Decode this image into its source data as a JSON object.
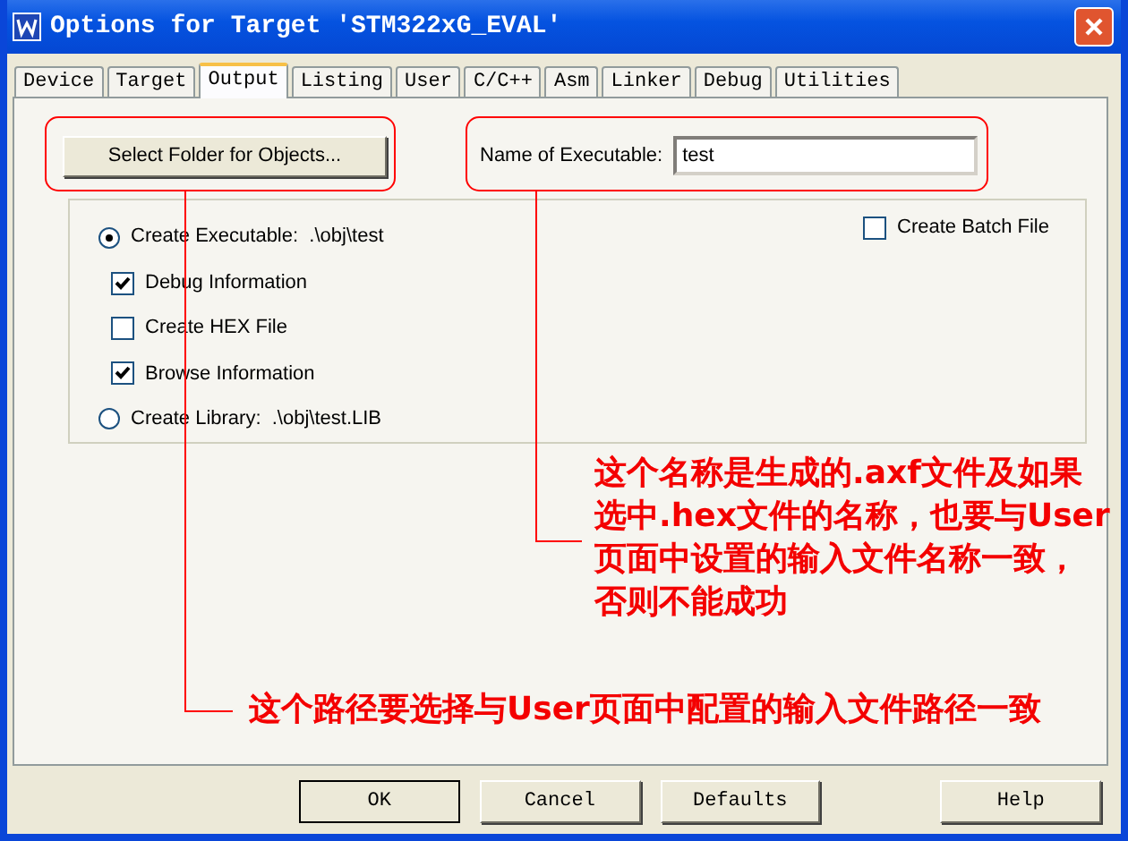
{
  "window": {
    "title": "Options for Target 'STM322xG_EVAL'"
  },
  "tabs": [
    {
      "label": "Device",
      "selected": false
    },
    {
      "label": "Target",
      "selected": false
    },
    {
      "label": "Output",
      "selected": true
    },
    {
      "label": "Listing",
      "selected": false
    },
    {
      "label": "User",
      "selected": false
    },
    {
      "label": "C/C++",
      "selected": false
    },
    {
      "label": "Asm",
      "selected": false
    },
    {
      "label": "Linker",
      "selected": false
    },
    {
      "label": "Debug",
      "selected": false
    },
    {
      "label": "Utilities",
      "selected": false
    }
  ],
  "output": {
    "select_folder_button": "Select Folder for Objects...",
    "name_label": "Name of Executable:",
    "name_value": "test",
    "options": [
      {
        "kind": "radio",
        "label": "Create Executable:  .\\obj\\test",
        "selected": true
      },
      {
        "kind": "checkbox",
        "label": "Debug Information",
        "checked": true
      },
      {
        "kind": "checkbox",
        "label": "Create HEX File",
        "checked": false
      },
      {
        "kind": "checkbox",
        "label": "Browse Information",
        "checked": true
      },
      {
        "kind": "radio",
        "label": "Create Library:  .\\obj\\test.LIB",
        "selected": false
      }
    ],
    "batch": {
      "label": "Create Batch File",
      "checked": false
    }
  },
  "annotations": [
    {
      "kind": "name",
      "lines": [
        "这个名称是生成的.axf文件及如果",
        "选中.hex文件的名称，也要与User",
        "页面中设置的输入文件名称一致，",
        "否则不能成功"
      ]
    },
    {
      "kind": "path",
      "lines": [
        "这个路径要选择与User页面中配置的输入文件路径一致"
      ]
    }
  ],
  "buttons": [
    {
      "label": "OK",
      "default": true
    },
    {
      "label": "Cancel",
      "default": false
    },
    {
      "label": "Defaults",
      "default": false
    },
    {
      "label": "Help",
      "default": false
    }
  ]
}
